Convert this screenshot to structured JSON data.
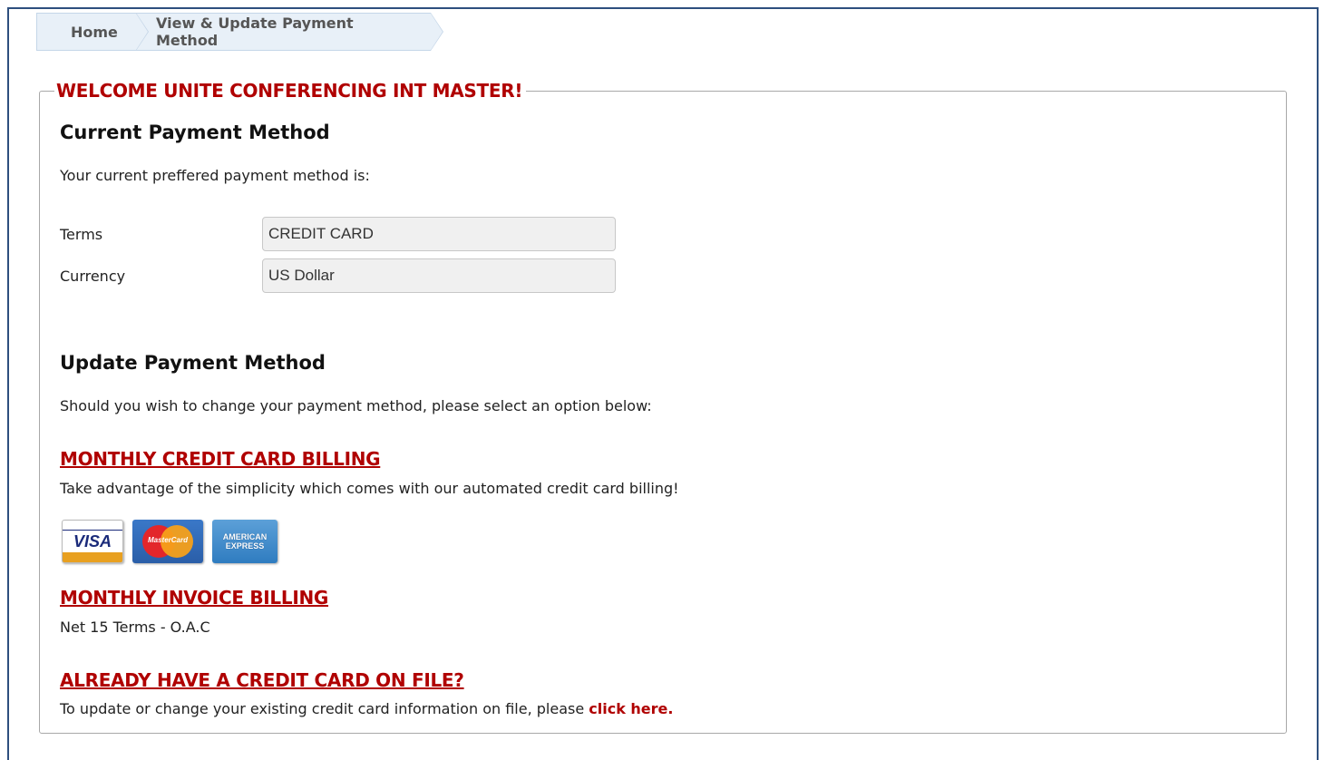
{
  "breadcrumb": {
    "home": "Home",
    "current": "View & Update Payment Method"
  },
  "welcome": "WELCOME UNITE CONFERENCING INT MASTER!",
  "current_section": {
    "title": "Current Payment Method",
    "intro": "Your current preffered payment method is:",
    "terms_label": "Terms",
    "terms_value": "CREDIT CARD",
    "currency_label": "Currency",
    "currency_value": "US Dollar"
  },
  "update_section": {
    "title": "Update Payment Method",
    "intro": "Should you wish to change your payment method, please select an option below:",
    "credit_card_link": "MONTHLY CREDIT CARD BILLING",
    "credit_card_desc": "Take advantage of the simplicity which comes with our automated credit card billing!",
    "cards": {
      "visa": "VISA",
      "mastercard": "MasterCard",
      "amex_line1": "AMERICAN",
      "amex_line2": "EXPRESS"
    },
    "invoice_link": "MONTHLY INVOICE BILLING",
    "invoice_desc": "Net 15 Terms - O.A.C",
    "on_file_link": "ALREADY HAVE A CREDIT CARD ON FILE?",
    "on_file_desc": "To update or change your existing credit card information on file, please",
    "on_file_click": "click here."
  },
  "colors": {
    "accent_red": "#b00000",
    "frame_blue": "#2e4f7e",
    "breadcrumb_bg": "#e8f0f8"
  }
}
